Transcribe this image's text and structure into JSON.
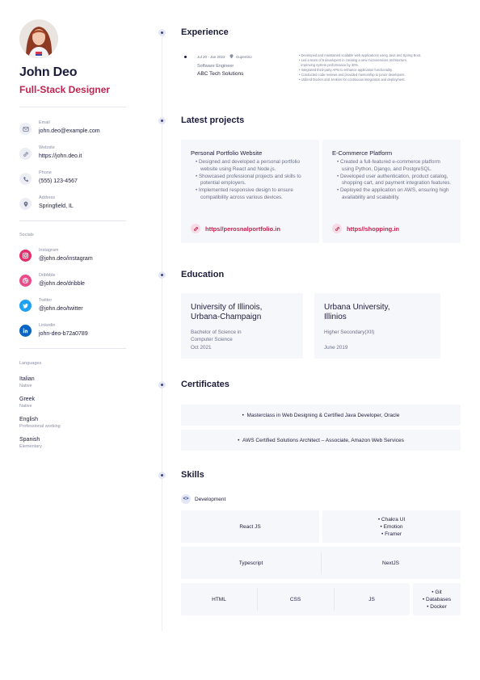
{
  "profile": {
    "name": "John Deo",
    "title": "Full-Stack Designer"
  },
  "contact": [
    {
      "label": "Email",
      "value": "john.deo@example.com",
      "icon": "mail-icon"
    },
    {
      "label": "Website",
      "value": "https://john.deo.it",
      "icon": "link-icon"
    },
    {
      "label": "Phone",
      "value": "(555) 123-4567",
      "icon": "phone-icon"
    },
    {
      "label": "Address",
      "value": "Springfield, IL",
      "icon": "location-icon"
    }
  ],
  "socials": {
    "heading": "Socials",
    "items": [
      {
        "label": "Instagram",
        "value": "@john.deo/instagram",
        "icon": "instagram-icon",
        "color": "#e1306c"
      },
      {
        "label": "Dribbble",
        "value": "@john.deo/dribble",
        "icon": "dribbble-icon",
        "color": "#ea4c89"
      },
      {
        "label": "Twitter",
        "value": "@john.deo/twitter",
        "icon": "twitter-icon",
        "color": "#1da1f2"
      },
      {
        "label": "Linkedin",
        "value": "john-deo-b72a0789",
        "icon": "linkedin-icon",
        "color": "#0a66c2"
      }
    ]
  },
  "languages": {
    "heading": "Languages",
    "items": [
      {
        "name": "Italian",
        "level": "Native"
      },
      {
        "name": "Greek",
        "level": "Native"
      },
      {
        "name": "English",
        "level": "Professional working"
      },
      {
        "name": "Spanish",
        "level": "Elementary"
      }
    ]
  },
  "sections": {
    "experience": "Experience",
    "projects": "Latest projects",
    "education": "Education",
    "certificates": "Certificates",
    "skills": "Skills"
  },
  "experience": {
    "dates": "Jul 20 - Jan 2022",
    "location": "Cupertino",
    "position": "Software Engineer",
    "company": "ABC Tech Solutions",
    "bullets": [
      "Developed and maintained scalable web applications using Java and Spring Boot.",
      "Led a team of 5 developers in creating a new microservices architecture,",
      "improving system performance by 30%.",
      "Integrated third-party APIs to enhance application functionality.",
      "Conducted code reviews and provided mentorship to junior developers.",
      "Utilized Docker and Jenkins for continuous integration and deployment."
    ]
  },
  "projects": [
    {
      "title": "Personal Portfolio Website",
      "bullets": [
        "Designed and developed a personal portfolio website using React and Node.js.",
        "Showcased professional projects and skills to potential employers.",
        "Implemented responsive design to ensure compatibility across various devices."
      ],
      "link": "https//perosnalportfolio.in"
    },
    {
      "title": "E-Commerce Platform",
      "bullets": [
        "Created a full-featured e-commerce platform using Python, Django, and PostgreSQL.",
        "Developed user authentication, product catalog, shopping cart, and payment integration features.",
        "Deployed the application on AWS, ensuring high availability and scalability."
      ],
      "link": "https//shopping.in"
    }
  ],
  "education": [
    {
      "school_line1": "University of Illinois,",
      "school_line2": "Urbana-Champaign",
      "degree_line1": "Bachelor of Science in",
      "degree_line2": "Computer Science",
      "date": "Oct 2021"
    },
    {
      "school_line1": "Urbana University,",
      "school_line2": "Illinios",
      "degree_line1": "Higher Secondary(XII)",
      "degree_line2": "",
      "date": "June 2019"
    }
  ],
  "certificates": [
    "Masterclass in Web Designing & Certified Java Developer, Oracle",
    "AWS Certified Solutions Architect – Associate, Amazon Web Services"
  ],
  "skills": {
    "category": "Development",
    "category_icon": "code-icon",
    "row1": {
      "single": "React JS",
      "list": [
        "Chakra UI",
        "Emotion",
        "Framer"
      ]
    },
    "row2": [
      "Typescript",
      "NextJS"
    ],
    "row3": {
      "cells": [
        "HTML",
        "CSS",
        "JS"
      ],
      "list": [
        "Git",
        "Databases",
        "Docker"
      ]
    }
  },
  "colors": {
    "accent": "#c0244f",
    "timeline_dot": "#3a3f8f",
    "card_bg": "#f6f7fb"
  }
}
